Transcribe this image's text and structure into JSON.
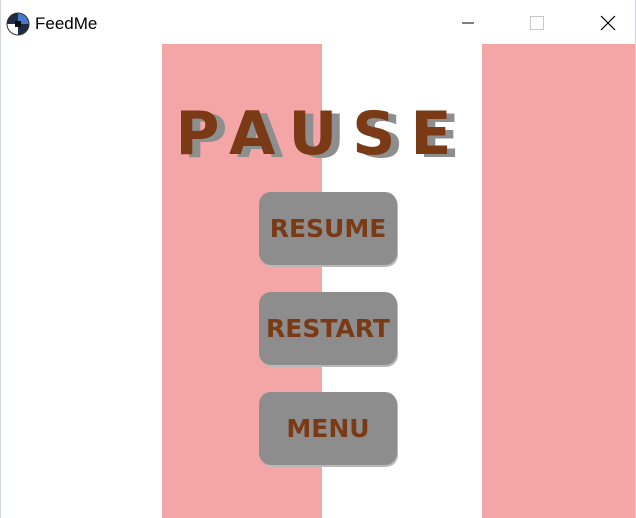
{
  "window": {
    "title": "FeedMe",
    "controls": {
      "minimize_icon": "minimize-icon",
      "maximize_icon": "maximize-icon",
      "close_icon": "close-icon"
    }
  },
  "game": {
    "pause_title": "PAUSE",
    "buttons": {
      "resume": "RESUME",
      "restart": "RESTART",
      "menu": "MENU"
    }
  },
  "colors": {
    "stripe": "#f4a6a6",
    "background": "#ffffff",
    "button_bg": "#8d8d8d",
    "text_brown": "#7a3a16",
    "title_shadow": "#8e8e8e"
  }
}
